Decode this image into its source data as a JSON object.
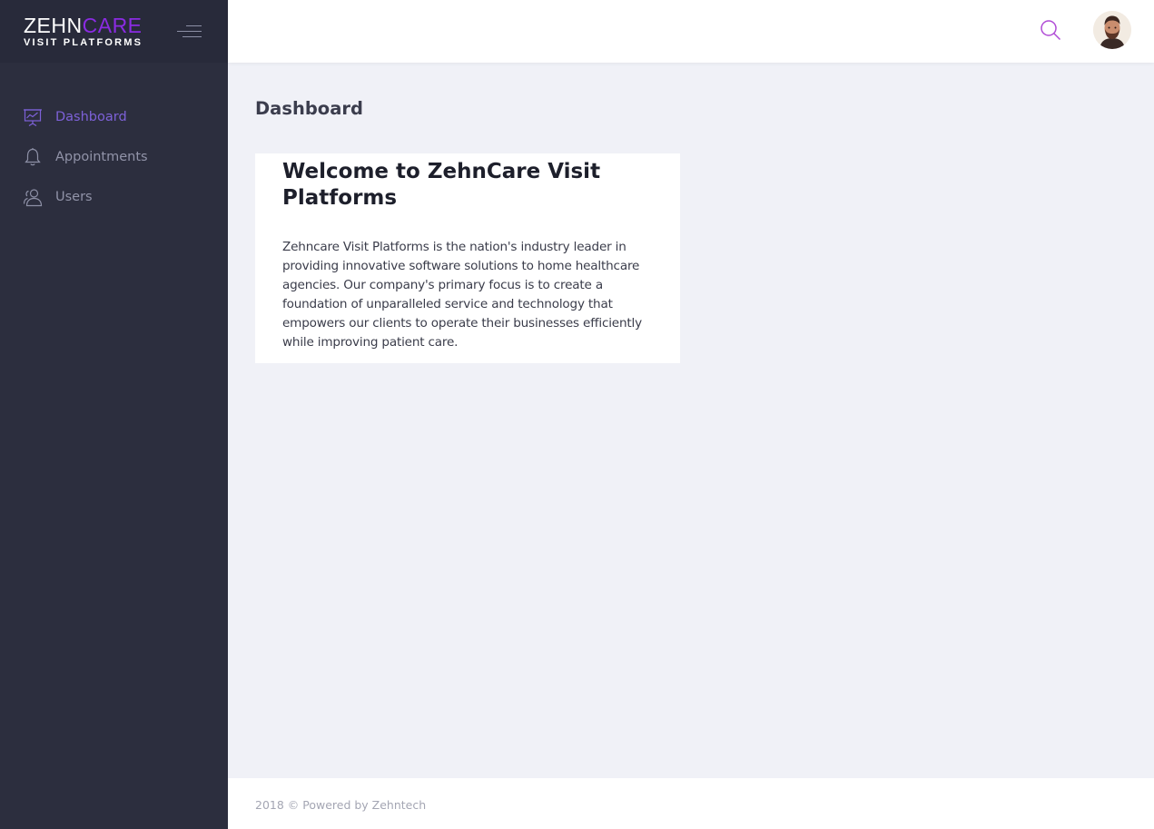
{
  "brand": {
    "logo_part1": "ZEHN",
    "logo_part2": "CARE",
    "logo_sub": "VISIT PLATFORMS",
    "accent_color": "#8a2be2"
  },
  "sidebar": {
    "items": [
      {
        "label": "Dashboard",
        "icon": "presentation-chart-icon",
        "active": true
      },
      {
        "label": "Appointments",
        "icon": "bell-icon",
        "active": false
      },
      {
        "label": "Users",
        "icon": "users-icon",
        "active": false
      }
    ],
    "active_color": "#7d61d8"
  },
  "topbar": {
    "search_icon": "search-icon",
    "avatar": "user-avatar"
  },
  "main": {
    "page_title": "Dashboard",
    "card": {
      "title": "Welcome to ZehnCare Visit Platforms",
      "text": "Zehncare Visit Platforms is the nation's industry leader in providing innovative software solutions to home healthcare agencies. Our company's primary focus is to create a foundation of unparalleled service and technology that empowers our clients to operate their businesses efficiently while improving patient care."
    }
  },
  "footer": {
    "text": "2018 © Powered by Zehntech"
  }
}
